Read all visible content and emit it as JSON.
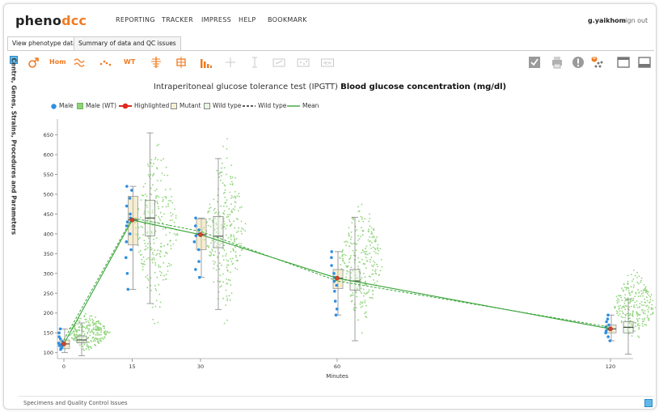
{
  "header": {
    "logo_part1": "pheno",
    "logo_part2": "dcc",
    "nav": [
      "REPORTING",
      "TRACKER",
      "IMPRESS",
      "HELP",
      "BOOKMARK"
    ],
    "user": "g.yaikhom",
    "signout": "sign out"
  },
  "tabs": [
    "View phenotype data",
    "Summary of data and QC issues"
  ],
  "toolbar": {
    "icons": [
      "male-icon",
      "hom-label",
      "line-plot-icon",
      "scatter-icon",
      "wt-label",
      "distribution-icon",
      "box-plot-icon",
      "bar-chart-icon",
      "crosshair-icon",
      "error-bar-icon",
      "scale-icon",
      "overlay-icon",
      "new-icon"
    ],
    "hom_label": "Hom",
    "wt_label": "WT",
    "right_icons": [
      "check-icon",
      "print-icon",
      "alert-icon",
      "filter-icon",
      "window-icon",
      "panel-icon"
    ],
    "badge": "0"
  },
  "sidebar_label": "Centre, Genes, Strains, Procedures and Parameters",
  "chart": {
    "title_normal": "Intraperitoneal glucose tolerance test (IPGTT)",
    "title_bold": "Blood glucose concentration (mg/dl)",
    "legend": [
      "Male",
      "Male (WT)",
      "Highlighted",
      "Mutant",
      "Wild type",
      "Wild type",
      "Mean"
    ],
    "colors": {
      "male": "#2e8fe0",
      "male_wt": "#8fd47a",
      "highlight": "#e0281e",
      "mutant_box": "#e8d898",
      "mean": "#3aa43a",
      "whisker": "#888888"
    }
  },
  "chart_data": {
    "type": "scatter",
    "xlabel": "Minutes",
    "ylabel": "",
    "x_ticks": [
      0,
      15,
      30,
      60,
      120
    ],
    "y_ticks": [
      100,
      150,
      200,
      250,
      300,
      350,
      400,
      450,
      500,
      550,
      600,
      650
    ],
    "ylim": [
      85,
      690
    ],
    "series": [
      {
        "name": "Mutant",
        "x": [
          0,
          15,
          30,
          60,
          120
        ],
        "values": [
          122,
          435,
          398,
          288,
          160
        ]
      },
      {
        "name": "Wild type",
        "x": [
          0,
          15,
          30,
          60,
          120
        ],
        "values": [
          132,
          440,
          406,
          281,
          164
        ]
      }
    ],
    "mutant_boxes": [
      {
        "x": 0,
        "q1": 110,
        "median": 122,
        "q3": 132,
        "min": 100,
        "max": 160
      },
      {
        "x": 15,
        "q1": 372,
        "median": 435,
        "q3": 495,
        "min": 260,
        "max": 520
      },
      {
        "x": 30,
        "q1": 360,
        "median": 398,
        "q3": 438,
        "min": 290,
        "max": 440
      },
      {
        "x": 60,
        "q1": 262,
        "median": 288,
        "q3": 310,
        "min": 195,
        "max": 355
      },
      {
        "x": 120,
        "q1": 150,
        "median": 160,
        "q3": 170,
        "min": 130,
        "max": 195
      }
    ],
    "wildtype_boxes": [
      {
        "x": 0,
        "q1": 125,
        "median": 132,
        "q3": 142,
        "min": 92,
        "max": 175
      },
      {
        "x": 15,
        "q1": 395,
        "median": 440,
        "q3": 485,
        "min": 224,
        "max": 655
      },
      {
        "x": 30,
        "q1": 365,
        "median": 394,
        "q3": 444,
        "min": 209,
        "max": 590
      },
      {
        "x": 60,
        "q1": 258,
        "median": 281,
        "q3": 310,
        "min": 130,
        "max": 442
      },
      {
        "x": 120,
        "q1": 150,
        "median": 164,
        "q3": 178,
        "min": 96,
        "max": 235
      }
    ],
    "wt_range": [
      {
        "x": 0,
        "min": 95,
        "max": 210
      },
      {
        "x": 15,
        "min": 140,
        "max": 690
      },
      {
        "x": 30,
        "min": 150,
        "max": 670
      },
      {
        "x": 60,
        "min": 140,
        "max": 525
      },
      {
        "x": 120,
        "min": 110,
        "max": 330
      }
    ],
    "mutant_points": [
      {
        "x": 0,
        "values": [
          108,
          112,
          115,
          118,
          120,
          124,
          128,
          135,
          140,
          150,
          160
        ]
      },
      {
        "x": 15,
        "values": [
          260,
          300,
          340,
          360,
          380,
          400,
          420,
          430,
          440,
          450,
          470,
          490,
          510,
          520
        ]
      },
      {
        "x": 30,
        "values": [
          290,
          310,
          330,
          360,
          380,
          395,
          400,
          410,
          420,
          440
        ]
      },
      {
        "x": 60,
        "values": [
          195,
          210,
          230,
          255,
          270,
          280,
          290,
          300,
          320,
          340,
          355
        ]
      },
      {
        "x": 120,
        "values": [
          130,
          140,
          150,
          155,
          160,
          165,
          170,
          178,
          185,
          195
        ]
      }
    ]
  },
  "footer": "Specimens and Quality Control Issues"
}
